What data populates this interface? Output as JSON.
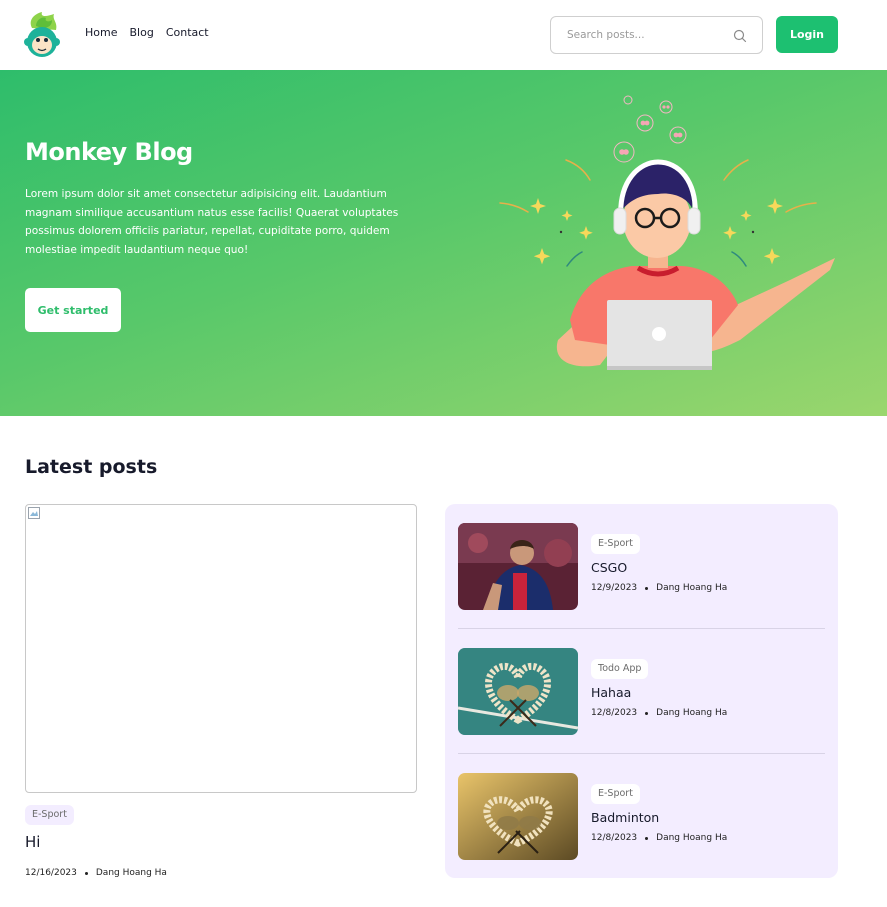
{
  "nav": {
    "items": [
      "Home",
      "Blog",
      "Contact"
    ]
  },
  "search": {
    "placeholder": "Search posts..."
  },
  "header": {
    "login_label": "Login"
  },
  "hero": {
    "title": "Monkey Blog",
    "description": "Lorem ipsum dolor sit amet consectetur adipisicing elit. Laudantium magnam similique accusantium natus esse facilis! Quaerat voluptates possimus dolorem officiis pariatur, repellat, cupiditate porro, quidem molestiae impedit laudantium neque quo!",
    "cta_label": "Get started"
  },
  "latest": {
    "title": "Latest posts",
    "feature": {
      "category": "E-Sport",
      "title": "Hi",
      "date": "12/16/2023",
      "author": "Dang Hoang Ha"
    },
    "side": [
      {
        "category": "E-Sport",
        "title": "CSGO",
        "date": "12/9/2023",
        "author": "Dang Hoang Ha"
      },
      {
        "category": "Todo App",
        "title": "Hahaa",
        "date": "12/8/2023",
        "author": "Dang Hoang Ha"
      },
      {
        "category": "E-Sport",
        "title": "Badminton",
        "date": "12/8/2023",
        "author": "Dang Hoang Ha"
      }
    ]
  },
  "colors": {
    "primary": "#1dc071",
    "secondary": "#a4d96c",
    "panel": "#f3edff"
  }
}
